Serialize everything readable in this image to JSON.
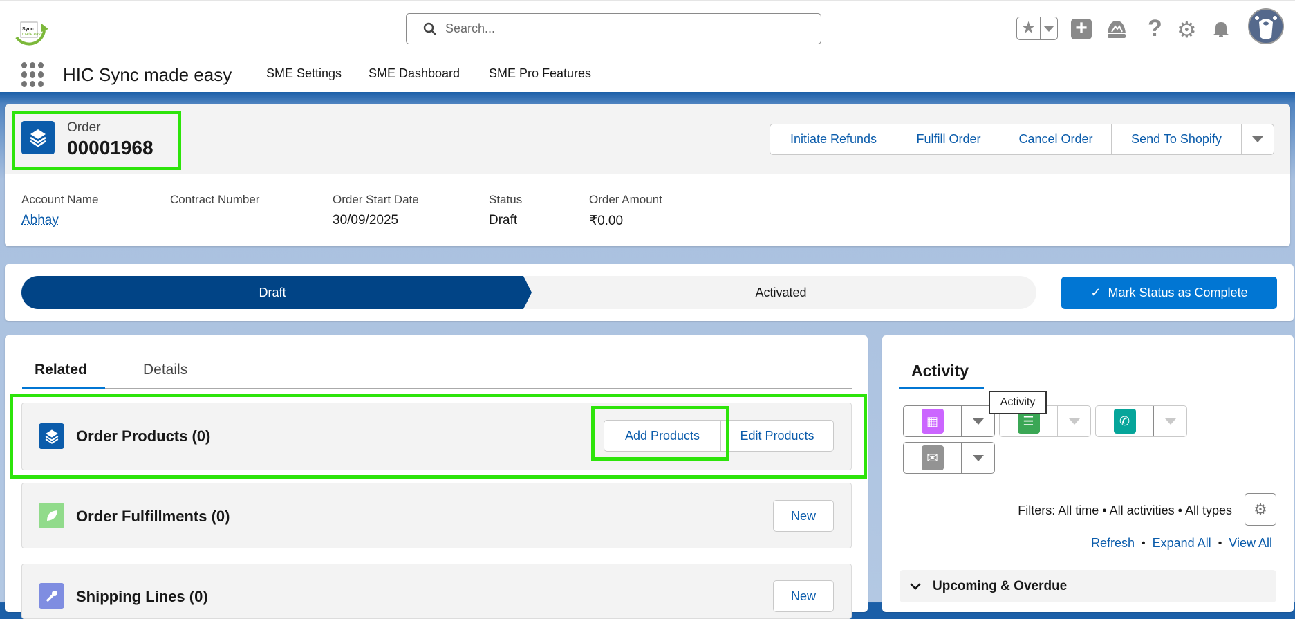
{
  "header": {
    "logo_text": "Sync made easy",
    "search_placeholder": "Search...",
    "app_name": "HIC Sync made easy",
    "nav": [
      "SME Settings",
      "SME Dashboard",
      "SME Pro Features"
    ]
  },
  "record": {
    "object_label": "Order",
    "number": "00001968",
    "actions": [
      "Initiate Refunds",
      "Fulfill Order",
      "Cancel Order",
      "Send To Shopify"
    ],
    "fields": [
      {
        "label": "Account Name",
        "value": "Abhay"
      },
      {
        "label": "Contract Number",
        "value": ""
      },
      {
        "label": "Order Start Date",
        "value": "30/09/2025"
      },
      {
        "label": "Status",
        "value": "Draft"
      },
      {
        "label": "Order Amount",
        "value": "₹0.00"
      }
    ]
  },
  "path": {
    "stages": [
      "Draft",
      "Activated"
    ],
    "current": "Draft",
    "mark_complete": "Mark Status as Complete"
  },
  "related": {
    "tabs": [
      "Related",
      "Details"
    ],
    "order_products": {
      "title": "Order Products (0)",
      "add": "Add Products",
      "edit": "Edit Products"
    },
    "order_fulfillments": {
      "title": "Order Fulfillments (0)",
      "new": "New"
    },
    "shipping_lines": {
      "title": "Shipping Lines (0)",
      "new": "New"
    }
  },
  "activity": {
    "tab": "Activity",
    "tooltip": "Activity",
    "filters": "Filters: All time • All activities • All types",
    "links": [
      "Refresh",
      "Expand All",
      "View All"
    ],
    "section": "Upcoming & Overdue"
  }
}
